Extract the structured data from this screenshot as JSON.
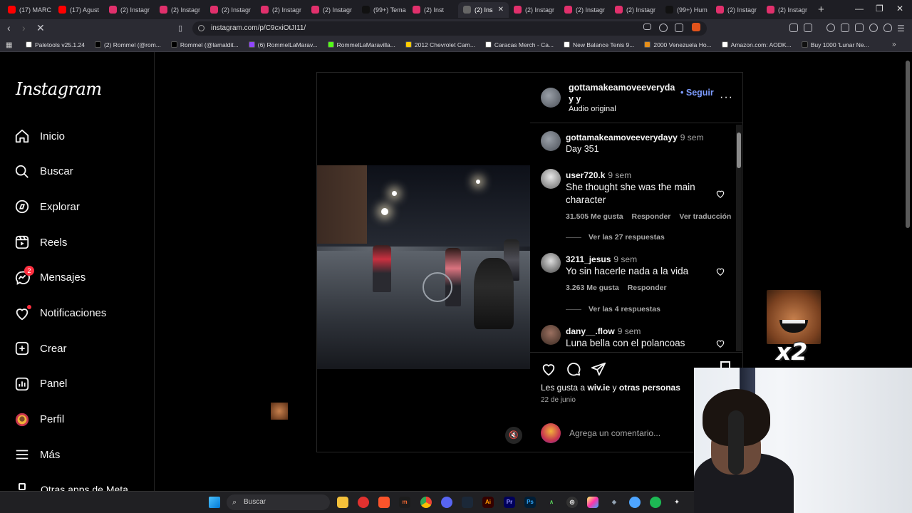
{
  "browser": {
    "tabs": [
      {
        "label": "(17) MARC",
        "color": "#ff0000"
      },
      {
        "label": "(17) Agust",
        "color": "#ff0000"
      },
      {
        "label": "(2) Instagr",
        "color": "#e1306c"
      },
      {
        "label": "(2) Instagr",
        "color": "#e1306c"
      },
      {
        "label": "(2) Instagr",
        "color": "#e1306c"
      },
      {
        "label": "(2) Instagr",
        "color": "#e1306c"
      },
      {
        "label": "(2) Instagr",
        "color": "#e1306c"
      },
      {
        "label": "(99+) Tema",
        "color": "#111111"
      },
      {
        "label": "(2) Inst",
        "color": "#e1306c"
      },
      {
        "label": "(2) Ins",
        "color": "#666666",
        "active": true
      },
      {
        "label": "(2) Instagr",
        "color": "#e1306c"
      },
      {
        "label": "(2) Instagr",
        "color": "#e1306c"
      },
      {
        "label": "(2) Instagr",
        "color": "#e1306c"
      },
      {
        "label": "(99+) Hum",
        "color": "#111111"
      },
      {
        "label": "(2) Instagr",
        "color": "#e1306c"
      },
      {
        "label": "(2) Instagr",
        "color": "#e1306c"
      }
    ],
    "url": "instagram.com/p/C9cxiOtJI11/",
    "bookmarks": [
      {
        "label": "Paletools v25.1.24",
        "color": "#ffffff"
      },
      {
        "label": "(2) Rommel (@rom...",
        "color": "#000000"
      },
      {
        "label": "Rommel (@lamaldit...",
        "color": "#000000"
      },
      {
        "label": "(6) RommelLaMarav...",
        "color": "#9146ff"
      },
      {
        "label": "RommelLaMaravilla...",
        "color": "#53fc18"
      },
      {
        "label": "2012 Chevrolet Cam...",
        "color": "#ffcc00"
      },
      {
        "label": "Caracas Merch - Ca...",
        "color": "#ffffff"
      },
      {
        "label": "New Balance Tenis 9...",
        "color": "#ffffff"
      },
      {
        "label": "2000 Venezuela Ho...",
        "color": "#e58e1a"
      },
      {
        "label": "Amazon.com: AODK...",
        "color": "#ffffff"
      },
      {
        "label": "Buy 1000 'Lunar Ne...",
        "color": "#111111"
      }
    ]
  },
  "sidebar": {
    "logo": "Instagram",
    "items": [
      {
        "label": "Inicio",
        "icon": "home-icon"
      },
      {
        "label": "Buscar",
        "icon": "search-icon"
      },
      {
        "label": "Explorar",
        "icon": "compass-icon"
      },
      {
        "label": "Reels",
        "icon": "reels-icon"
      },
      {
        "label": "Mensajes",
        "icon": "messenger-icon",
        "badge": "2"
      },
      {
        "label": "Notificaciones",
        "icon": "heart-icon",
        "dot": true
      },
      {
        "label": "Crear",
        "icon": "plus-square-icon"
      },
      {
        "label": "Panel",
        "icon": "dashboard-icon"
      },
      {
        "label": "Perfil",
        "icon": "profile-avatar-icon"
      },
      {
        "label": "Más",
        "icon": "menu-icon"
      }
    ],
    "clipped_item": "Otras apps de Meta"
  },
  "post": {
    "author": "gottamakeamoveeveryday y",
    "follow_label": "Seguir",
    "follow_bullet": "•",
    "audio": "Audio original",
    "caption": {
      "user": "gottamakeamoveeverydayy",
      "time": "9 sem",
      "text": "Day 351"
    },
    "comments": [
      {
        "user": "user720.k",
        "time": "9 sem",
        "text": "She thought she was the main character",
        "likes": "31.505 Me gusta",
        "reply": "Responder",
        "translate": "Ver traducción",
        "replies": "Ver las 27 respuestas"
      },
      {
        "user": "3211_jesus",
        "time": "9 sem",
        "text": "Yo sin hacerle nada a la vida",
        "likes": "3.263 Me gusta",
        "reply": "Responder",
        "replies": "Ver las 4 respuestas"
      },
      {
        "user": "dany__.flow",
        "time": "9 sem",
        "text": "Luna bella con el polancoas"
      }
    ],
    "likes_prefix": "Les gusta a",
    "likes_user": "wiv.ie",
    "likes_and": "y",
    "likes_others": "otras personas",
    "date": "22 de junio",
    "comment_placeholder": "Agrega un comentario..."
  },
  "overlay": {
    "meme_text": "x2"
  },
  "taskbar": {
    "search": "Buscar"
  },
  "colors": {
    "accent_link": "#7d9cff",
    "background": "#000000",
    "notification": "#ff3040"
  }
}
